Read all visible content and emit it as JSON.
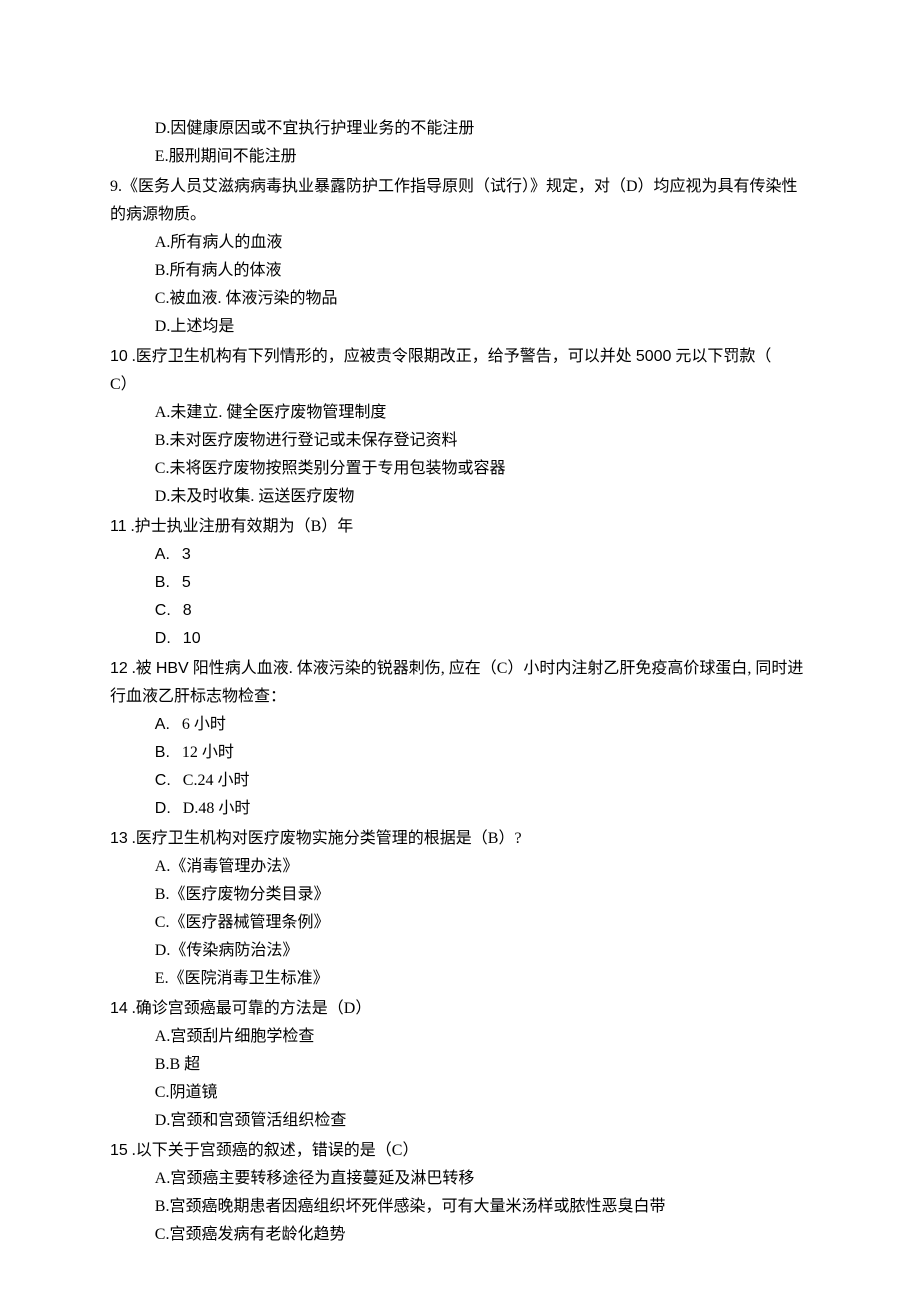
{
  "pre_options": [
    "D.因健康原因或不宜执行护理业务的不能注册",
    "E.服刑期间不能注册"
  ],
  "q9": {
    "stem": "9.《医务人员艾滋病病毒执业暴露防护工作指导原则（试行）》规定，对（D）均应视为具有传染性的病源物质。",
    "opts": [
      "A.所有病人的血液",
      "B.所有病人的体液",
      "C.被血液. 体液污染的物品",
      "D.上述均是"
    ]
  },
  "q10": {
    "stem_pre": "10",
    "stem": " .医疗卫生机构有下列情形的，应被责令限期改正，给予警告，可以并处 ",
    "stem_num": "5000",
    "stem_post": " 元以下罚款（",
    "stem_line2": "C）",
    "opts": [
      "A.未建立. 健全医疗废物管理制度",
      "B.未对医疗废物进行登记或未保存登记资料",
      "C.未将医疗废物按照类别分置于专用包装物或容器",
      "D.未及时收集. 运送医疗废物"
    ]
  },
  "q11": {
    "stem_pre": "11",
    "stem": " .护士执业注册有效期为（B）年",
    "opts": [
      {
        "label": "A.",
        "val": "3"
      },
      {
        "label": "B.",
        "val": "5"
      },
      {
        "label": "C.",
        "val": "8"
      },
      {
        "label": "D.",
        "val": "10"
      }
    ]
  },
  "q12": {
    "stem_pre": "12",
    "stem_a": " .被 ",
    "stem_hbv": "HBV",
    "stem_b": " 阳性病人血液. 体液污染的锐器刺伤, 应在（C）小时内注射乙肝免疫高价球蛋白, 同时进行血液乙肝标志物检查：",
    "opts": [
      {
        "label": "A.",
        "val": "6 小时"
      },
      {
        "label": "B.",
        "val": "12 小时"
      },
      {
        "label": "C.",
        "val": "C.24 小时"
      },
      {
        "label": "D.",
        "val": "D.48 小时"
      }
    ]
  },
  "q13": {
    "stem_pre": "13",
    "stem": " .医疗卫生机构对医疗废物实施分类管理的根据是（B）?",
    "opts": [
      "A.《消毒管理办法》",
      "B.《医疗废物分类目录》",
      "C.《医疗器械管理条例》",
      "D.《传染病防治法》",
      "E.《医院消毒卫生标准》"
    ]
  },
  "q14": {
    "stem_pre": "14",
    "stem": " .确诊宫颈癌最可靠的方法是（D）",
    "opts": [
      "A.宫颈刮片细胞学检查",
      "B.B 超",
      "C.阴道镜",
      "D.宫颈和宫颈管活组织检查"
    ]
  },
  "q15": {
    "stem_pre": "15",
    "stem": " .以下关于宫颈癌的叙述，错误的是（C）",
    "opts": [
      "A.宫颈癌主要转移途径为直接蔓延及淋巴转移",
      "B.宫颈癌晚期患者因癌组织坏死伴感染，可有大量米汤样或脓性恶臭白带",
      "C.宫颈癌发病有老龄化趋势"
    ]
  }
}
